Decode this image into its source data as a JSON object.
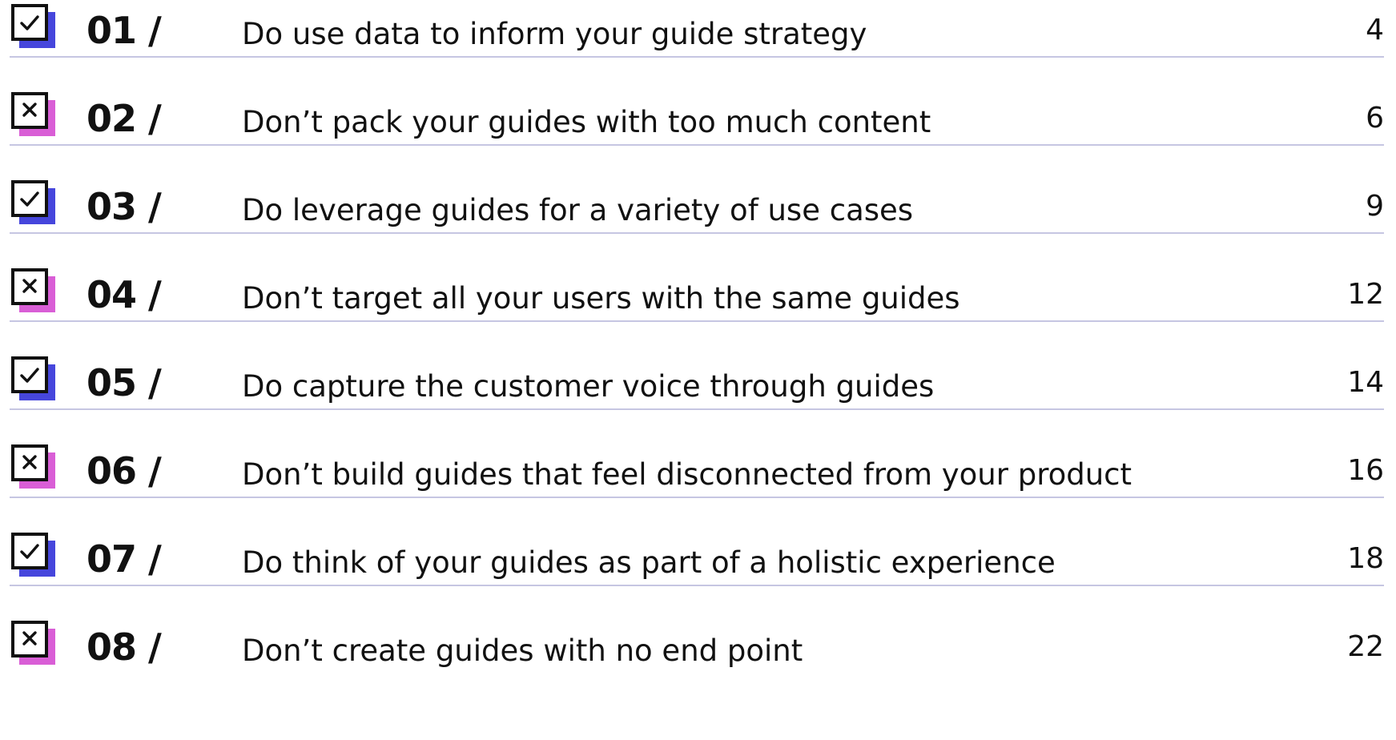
{
  "toc": {
    "entries": [
      {
        "status": "do",
        "status_icon": "checkbox-checked-icon",
        "number": "01 /",
        "title": "Do use data to inform your guide strategy",
        "page": "4"
      },
      {
        "status": "dont",
        "status_icon": "checkbox-x-icon",
        "number": "02 /",
        "title": "Don’t pack your guides with too much content",
        "page": "6"
      },
      {
        "status": "do",
        "status_icon": "checkbox-checked-icon",
        "number": "03 /",
        "title": "Do leverage guides for a variety of use cases",
        "page": "9"
      },
      {
        "status": "dont",
        "status_icon": "checkbox-x-icon",
        "number": "04 /",
        "title": "Don’t target all your users with the same guides",
        "page": "12"
      },
      {
        "status": "do",
        "status_icon": "checkbox-checked-icon",
        "number": "05 /",
        "title": "Do capture the customer voice through guides",
        "page": "14"
      },
      {
        "status": "dont",
        "status_icon": "checkbox-x-icon",
        "number": "06 /",
        "title": "Don’t build guides that feel disconnected from your product",
        "page": "16"
      },
      {
        "status": "do",
        "status_icon": "checkbox-checked-icon",
        "number": "07 /",
        "title": "Do think of your guides as part of a holistic experience",
        "page": "18"
      },
      {
        "status": "dont",
        "status_icon": "checkbox-x-icon",
        "number": "08 /",
        "title": "Don’t create guides with no end point",
        "page": "22"
      }
    ]
  },
  "colors": {
    "do_accent": "#4646dc",
    "dont_accent": "#d95ed6",
    "rule": "#c6c6e2",
    "text": "#111111"
  }
}
